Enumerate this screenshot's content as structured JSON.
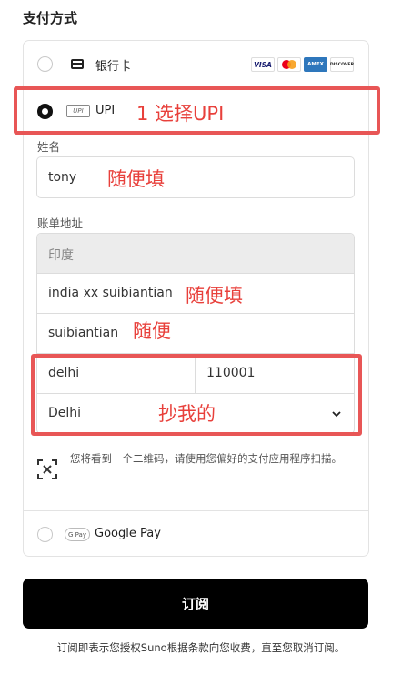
{
  "section_title": "支付方式",
  "payment_options": {
    "card_label": "银行卡",
    "card_brands": [
      "VISA",
      "AMEX",
      "DISCOVER"
    ],
    "upi_logo": "UPI",
    "upi_label": "UPI",
    "google_pay_logo": "G Pay",
    "google_pay_label": "Google Pay"
  },
  "form": {
    "name_label": "姓名",
    "name_value": "tony",
    "address_label": "账单地址",
    "country_value": "印度",
    "address_line1": "india xx suibiantian",
    "address_line2": "suibiantian",
    "city": "delhi",
    "postal_code": "110001",
    "state": "Delhi"
  },
  "qr_notice": "您将看到一个二维码，请使用您偏好的支付应用程序扫描。",
  "submit_label": "订阅",
  "footer_text": "订阅即表示您授权Suno根据条款向您收费，直至您取消订阅。",
  "annotations": {
    "select_upi": "1 选择UPI",
    "fill_name": "随便填",
    "fill_address": "随便填",
    "fill_address2": "随便",
    "copy_mine": "抄我的"
  },
  "colors": {
    "annotation_red": "#e8403b",
    "button_bg": "#000000",
    "mastercard_red": "#eb001b",
    "mastercard_orange": "#f79e1b",
    "visa_blue": "#1a1f71",
    "amex_blue": "#2e77bc"
  }
}
